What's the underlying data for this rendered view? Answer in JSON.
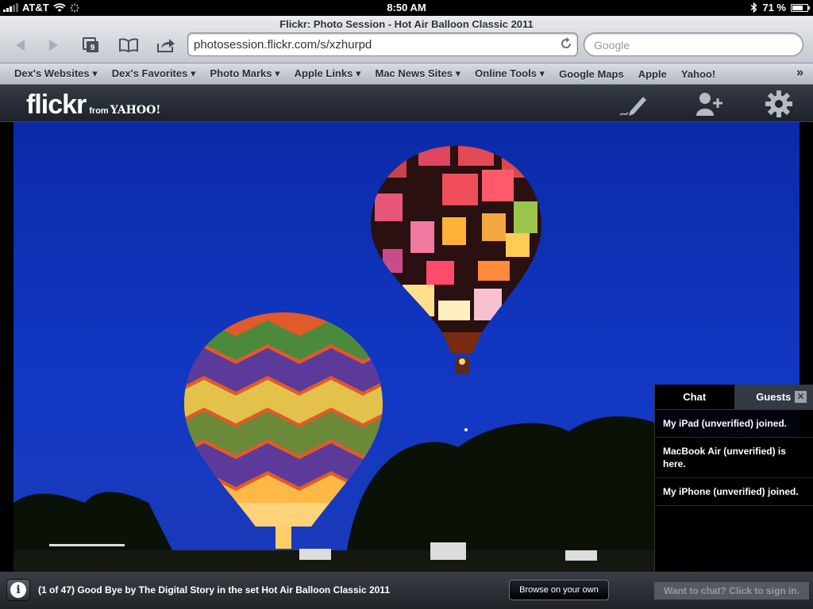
{
  "status_bar": {
    "carrier": "AT&T",
    "time": "8:50 AM",
    "battery": "71 %",
    "battery_level": 0.71
  },
  "browser": {
    "window_title": "Flickr: Photo Session - Hot Air Balloon Classic 2011",
    "tab_count": "9",
    "url": "photosession.flickr.com/s/xzhurpd",
    "search_placeholder": "Google"
  },
  "bookmarks": [
    {
      "label": "Dex's Websites ▾"
    },
    {
      "label": "Dex's Favorites ▾"
    },
    {
      "label": "Photo Marks ▾"
    },
    {
      "label": "Apple Links ▾"
    },
    {
      "label": "Mac News Sites ▾"
    },
    {
      "label": "Online Tools ▾"
    },
    {
      "label": "Google Maps"
    },
    {
      "label": "Apple"
    },
    {
      "label": "Yahoo!"
    }
  ],
  "flickr": {
    "logo_word": "flickr",
    "logo_from": "from",
    "logo_yahoo": "YAHOO!",
    "icons": [
      "pen-icon",
      "add-person-icon",
      "gear-icon"
    ]
  },
  "chat": {
    "tab_chat": "Chat",
    "tab_guests": "Guests",
    "close": "✕",
    "messages": [
      "My iPad (unverified) joined.",
      "MacBook Air (unverified) is here.",
      "My iPhone (unverified) joined."
    ]
  },
  "footer": {
    "info": "i",
    "caption": "(1 of 47) Good Bye by The Digital Story in the set Hot Air Balloon Classic 2011",
    "browse_label": "Browse on your own",
    "signin_label": "Want to chat? Click to sign in."
  },
  "colors": {
    "sky": "#0f2db3",
    "toolbar": "#c5c9cf",
    "flickr_bar": "#1d222a"
  }
}
